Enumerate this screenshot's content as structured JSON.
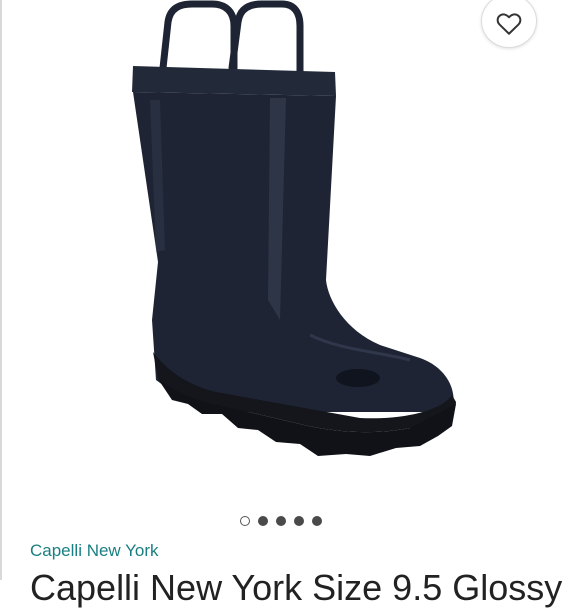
{
  "favorite": {
    "icon": "heart-icon"
  },
  "product": {
    "image_alt": "Navy rain boot with pull handles",
    "brand": "Capelli New York",
    "title": "Capelli New York Size 9.5 Glossy"
  },
  "carousel": {
    "count": 5,
    "active_index": 0
  },
  "colors": {
    "brand_link": "#1a7f82",
    "boot": "#1e2433",
    "sole": "#14161c"
  }
}
